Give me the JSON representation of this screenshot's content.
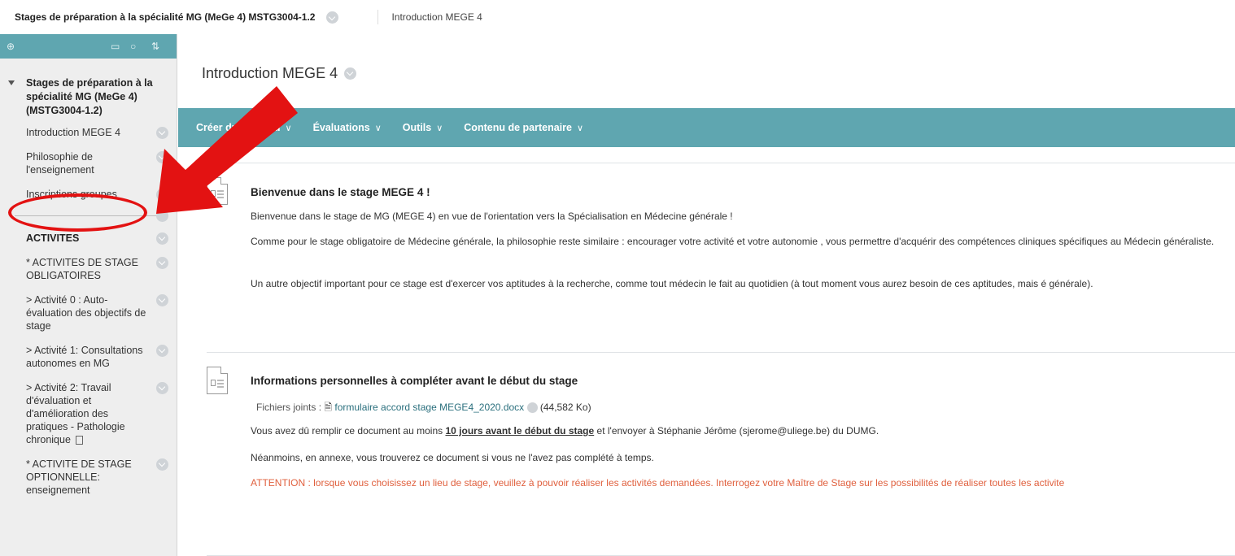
{
  "breadcrumb": {
    "course": "Stages de préparation à la spécialité MG (MeGe 4) MSTG3004-1.2",
    "page": "Introduction MEGE 4"
  },
  "sidebar": {
    "course_title": "Stages de préparation à la spécialité MG (MeGe 4) (MSTG3004-1.2)",
    "items": [
      {
        "label": "Introduction MEGE 4"
      },
      {
        "label": "Philosophie de l'enseignement"
      },
      {
        "label": "Inscriptions groupes"
      }
    ],
    "heading": "ACTIVITES",
    "activities": [
      {
        "label": "* ACTIVITES DE STAGE OBLIGATOIRES"
      },
      {
        "label": "> Activité 0 : Auto-évaluation des objectifs de stage"
      },
      {
        "label": "> Activité 1: Consultations autonomes en MG"
      },
      {
        "label": "> Activité 2: Travail d'évaluation et d'amélioration des pratiques - Pathologie chronique"
      },
      {
        "label": "* ACTIVITE DE STAGE OPTIONNELLE: enseignement"
      }
    ]
  },
  "main": {
    "title": "Introduction MEGE 4",
    "actions": [
      "Créer du contenu",
      "Évaluations",
      "Outils",
      "Contenu de partenaire"
    ],
    "items": [
      {
        "title": "Bienvenue dans le stage MEGE 4 !",
        "p1": "Bienvenue dans le stage de MG (MEGE 4) en vue de l'orientation vers la Spécialisation en Médecine générale !",
        "p2": "Comme pour le stage obligatoire de Médecine générale, la philosophie reste similaire : encourager votre activité et votre autonomie , vous permettre d'acquérir des compétences cliniques spécifiques au Médecin généraliste.",
        "p3": "Un autre objectif important pour ce stage est d'exercer vos aptitudes à la recherche, comme tout médecin le fait au quotidien (à tout moment vous aurez besoin de ces aptitudes, mais é générale)."
      },
      {
        "title": "Informations personnelles à compléter avant le début du stage",
        "attach_label": "Fichiers joints :",
        "attach_file": "formulaire accord stage MEGE4_2020.docx",
        "attach_size": "(44,582 Ko)",
        "p1_before": "Vous avez dû remplir ce document au moins ",
        "p1_bold": "10 jours avant le début du stage",
        "p1_after": " et l'envoyer à Stéphanie Jérôme (sjerome@uliege.be) du DUMG.",
        "p2": "Néanmoins, en annexe, vous trouverez ce document si vous ne l'avez pas complété à temps.",
        "p3": "ATTENTION : lorsque vous choisissez un lieu de stage, veuillez à pouvoir réaliser les activités demandées. Interrogez votre Maître de Stage sur les possibilités de réaliser toutes les activite"
      }
    ]
  },
  "colors": {
    "accent": "#5fa6b0",
    "annotation": "#e31212",
    "warning": "#e0603e"
  }
}
